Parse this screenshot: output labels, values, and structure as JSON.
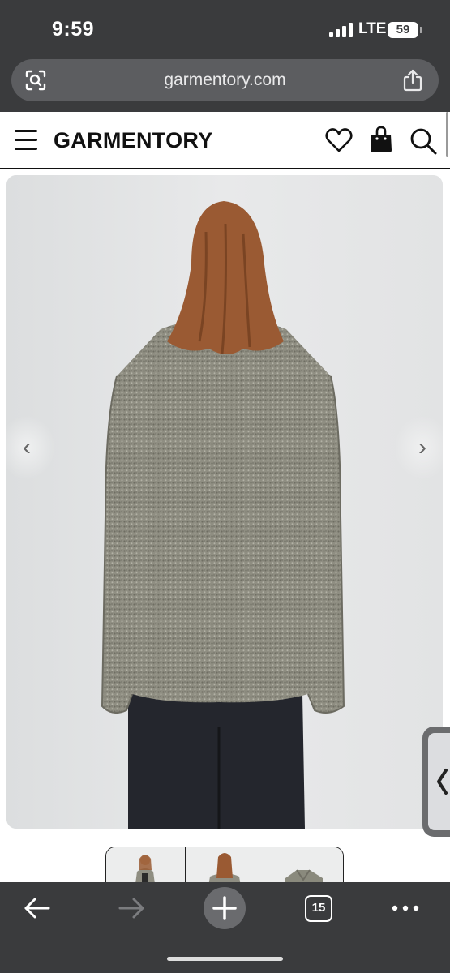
{
  "status_bar": {
    "time": "9:59",
    "network": "LTE",
    "battery": "59"
  },
  "browser": {
    "url": "garmentory.com",
    "left_icon": "lens-scan-icon",
    "right_icon": "share-icon"
  },
  "site_header": {
    "logo": "GARMENTORY",
    "icons": [
      "hamburger-menu-icon",
      "heart-icon",
      "shopping-bag-icon",
      "search-icon"
    ]
  },
  "product_gallery": {
    "prev_arrow": "‹",
    "next_arrow": "›",
    "thumbnail_count": 3
  },
  "side_tab": {
    "glyph": "‹"
  },
  "toolbar": {
    "back": "back-arrow-icon",
    "forward": "forward-arrow-icon",
    "new_tab": "plus-icon",
    "tab_count": "15",
    "more": "more-dots-icon"
  },
  "colors": {
    "chrome": "#3a3b3d",
    "url_bar": "#5c5d60",
    "image_bg": "#e5e6e7",
    "sweater": "#8d8c80"
  }
}
